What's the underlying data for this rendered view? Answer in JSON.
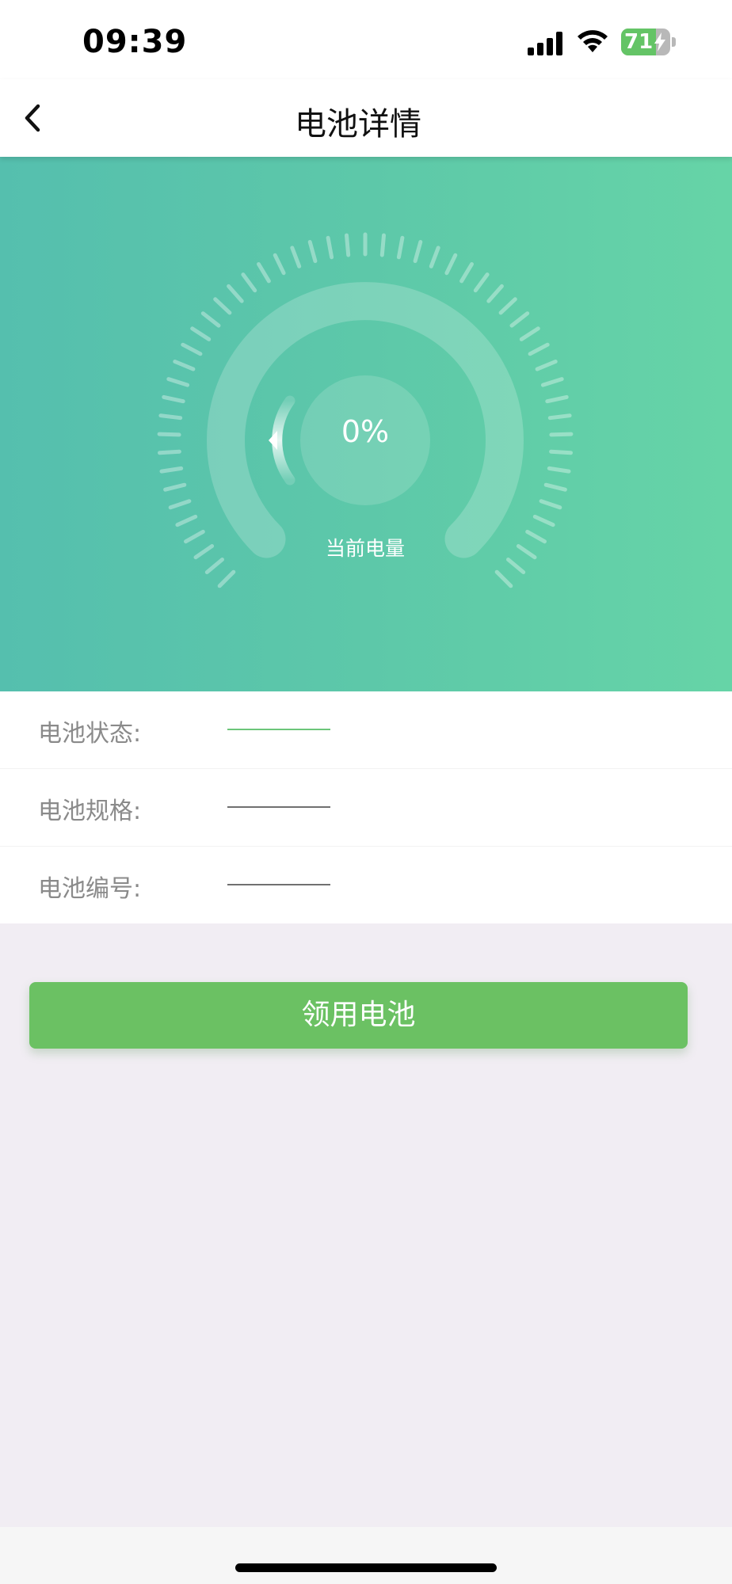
{
  "status_bar": {
    "time": "09:39",
    "battery_level": "71",
    "battery_fraction": 0.71,
    "icons": [
      "signal-icon",
      "wifi-icon",
      "battery-charging-icon"
    ]
  },
  "nav": {
    "title": "电池详情",
    "back_icon": "chevron-left-icon"
  },
  "gauge": {
    "charge_text": "0%",
    "charge_fraction": 0,
    "caption": "当前电量"
  },
  "info": {
    "rows": [
      {
        "label": "电池状态:",
        "value": ""
      },
      {
        "label": "电池规格:",
        "value": ""
      },
      {
        "label": "电池编号:",
        "value": ""
      }
    ]
  },
  "actions": {
    "claim_label": "领用电池"
  },
  "colors": {
    "accent": "#6bc163",
    "hero_start": "#55bfae",
    "hero_end": "#66d4a7"
  }
}
